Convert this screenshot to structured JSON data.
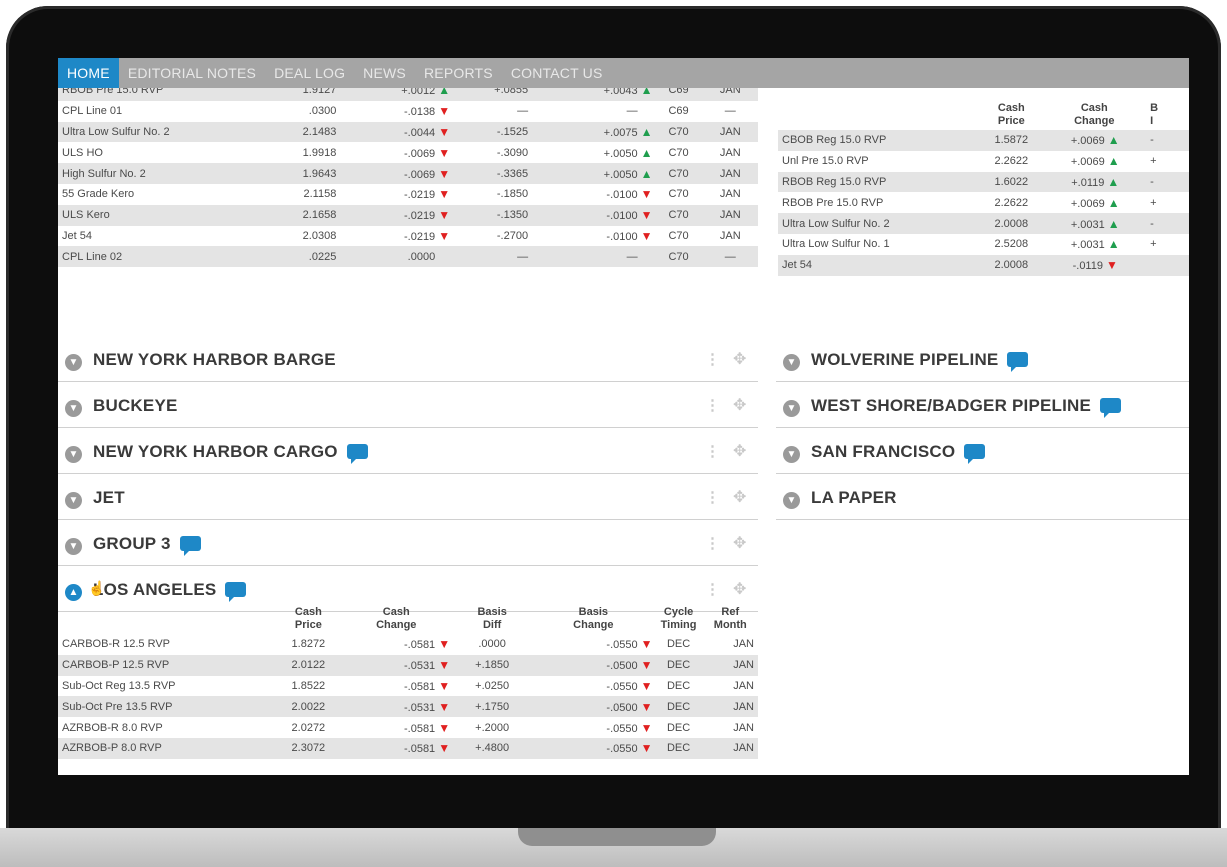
{
  "nav": {
    "items": [
      "HOME",
      "EDITORIAL NOTES",
      "DEAL LOG",
      "NEWS",
      "REPORTS",
      "CONTACT US"
    ]
  },
  "top_left_table": {
    "rows": [
      {
        "name": "RBOB Pre 15.0 RVP",
        "price": "1.9127",
        "cash_change": "+.0012",
        "cash_dir": "up",
        "basis": "+.0855",
        "basis_change": "+.0043",
        "basis_dir": "up",
        "cycle": "C69",
        "ref": "JAN"
      },
      {
        "name": "CPL Line 01",
        "price": ".0300",
        "cash_change": "-.0138",
        "cash_dir": "down",
        "basis": "—",
        "basis_change": "—",
        "basis_dir": "",
        "cycle": "C69",
        "ref": "—"
      },
      {
        "name": "Ultra Low Sulfur No. 2",
        "price": "2.1483",
        "cash_change": "-.0044",
        "cash_dir": "down",
        "basis": "-.1525",
        "basis_change": "+.0075",
        "basis_dir": "up",
        "cycle": "C70",
        "ref": "JAN"
      },
      {
        "name": "ULS HO",
        "price": "1.9918",
        "cash_change": "-.0069",
        "cash_dir": "down",
        "basis": "-.3090",
        "basis_change": "+.0050",
        "basis_dir": "up",
        "cycle": "C70",
        "ref": "JAN"
      },
      {
        "name": "High Sulfur No. 2",
        "price": "1.9643",
        "cash_change": "-.0069",
        "cash_dir": "down",
        "basis": "-.3365",
        "basis_change": "+.0050",
        "basis_dir": "up",
        "cycle": "C70",
        "ref": "JAN"
      },
      {
        "name": "55 Grade Kero",
        "price": "2.1158",
        "cash_change": "-.0219",
        "cash_dir": "down",
        "basis": "-.1850",
        "basis_change": "-.0100",
        "basis_dir": "down",
        "cycle": "C70",
        "ref": "JAN"
      },
      {
        "name": "ULS Kero",
        "price": "2.1658",
        "cash_change": "-.0219",
        "cash_dir": "down",
        "basis": "-.1350",
        "basis_change": "-.0100",
        "basis_dir": "down",
        "cycle": "C70",
        "ref": "JAN"
      },
      {
        "name": "Jet 54",
        "price": "2.0308",
        "cash_change": "-.0219",
        "cash_dir": "down",
        "basis": "-.2700",
        "basis_change": "-.0100",
        "basis_dir": "down",
        "cycle": "C70",
        "ref": "JAN"
      },
      {
        "name": "CPL Line 02",
        "price": ".0225",
        "cash_change": ".0000",
        "cash_dir": "",
        "basis": "—",
        "basis_change": "—",
        "basis_dir": "",
        "cycle": "C70",
        "ref": "—"
      }
    ]
  },
  "top_right_table": {
    "headers": {
      "price_1": "Cash",
      "price_2": "Price",
      "change_1": "Cash",
      "change_2": "Change",
      "partial_1": "B",
      "partial_2": "I"
    },
    "rows": [
      {
        "name": "CBOB Reg 15.0 RVP",
        "price": "1.5872",
        "change": "+.0069",
        "dir": "up",
        "partial": "-"
      },
      {
        "name": "Unl Pre 15.0 RVP",
        "price": "2.2622",
        "change": "+.0069",
        "dir": "up",
        "partial": "+"
      },
      {
        "name": "RBOB Reg 15.0 RVP",
        "price": "1.6022",
        "change": "+.0119",
        "dir": "up",
        "partial": "-"
      },
      {
        "name": "RBOB Pre 15.0 RVP",
        "price": "2.2622",
        "change": "+.0069",
        "dir": "up",
        "partial": "+"
      },
      {
        "name": "Ultra Low Sulfur No. 2",
        "price": "2.0008",
        "change": "+.0031",
        "dir": "up",
        "partial": "-"
      },
      {
        "name": "Ultra Low Sulfur No. 1",
        "price": "2.5208",
        "change": "+.0031",
        "dir": "up",
        "partial": "+"
      },
      {
        "name": "Jet 54",
        "price": "2.0008",
        "change": "-.0119",
        "dir": "down",
        "partial": ""
      }
    ]
  },
  "panels_left": [
    {
      "title": "NEW YORK HARBOR BARGE",
      "chat": false
    },
    {
      "title": "BUCKEYE",
      "chat": false
    },
    {
      "title": "NEW YORK HARBOR CARGO",
      "chat": true
    },
    {
      "title": "JET",
      "chat": false
    },
    {
      "title": "GROUP 3",
      "chat": true
    },
    {
      "title": "LOS ANGELES",
      "chat": true
    }
  ],
  "panels_right": [
    {
      "title": "WOLVERINE PIPELINE",
      "chat": true
    },
    {
      "title": "WEST SHORE/BADGER PIPELINE",
      "chat": true
    },
    {
      "title": "SAN FRANCISCO",
      "chat": true
    },
    {
      "title": "LA PAPER",
      "chat": false
    }
  ],
  "la_table": {
    "headers": {
      "cash_price": [
        "Cash",
        "Price"
      ],
      "cash_change": [
        "Cash",
        "Change"
      ],
      "basis_diff": [
        "Basis",
        "Diff"
      ],
      "basis_change": [
        "Basis",
        "Change"
      ],
      "cycle_timing": [
        "Cycle",
        "Timing"
      ],
      "ref_month": [
        "Ref",
        "Month"
      ]
    },
    "rows": [
      {
        "name": "CARBOB-R 12.5 RVP",
        "price": "1.8272",
        "cash_change": "-.0581",
        "basis": ".0000",
        "basis_change": "-.0550",
        "cycle": "DEC",
        "ref": "JAN"
      },
      {
        "name": "CARBOB-P 12.5 RVP",
        "price": "2.0122",
        "cash_change": "-.0531",
        "basis": "+.1850",
        "basis_change": "-.0500",
        "cycle": "DEC",
        "ref": "JAN"
      },
      {
        "name": "Sub-Oct Reg 13.5 RVP",
        "price": "1.8522",
        "cash_change": "-.0581",
        "basis": "+.0250",
        "basis_change": "-.0550",
        "cycle": "DEC",
        "ref": "JAN"
      },
      {
        "name": "Sub-Oct Pre 13.5 RVP",
        "price": "2.0022",
        "cash_change": "-.0531",
        "basis": "+.1750",
        "basis_change": "-.0500",
        "cycle": "DEC",
        "ref": "JAN"
      },
      {
        "name": "AZRBOB-R 8.0 RVP",
        "price": "2.0272",
        "cash_change": "-.0581",
        "basis": "+.2000",
        "basis_change": "-.0550",
        "cycle": "DEC",
        "ref": "JAN"
      },
      {
        "name": "AZRBOB-P 8.0 RVP",
        "price": "2.3072",
        "cash_change": "-.0581",
        "basis": "+.4800",
        "basis_change": "-.0550",
        "cycle": "DEC",
        "ref": "JAN"
      }
    ]
  },
  "colors": {
    "accent": "#1e88c7",
    "up": "#1f9e4e",
    "down": "#e02020",
    "nav_bg": "#a5a5a5"
  }
}
